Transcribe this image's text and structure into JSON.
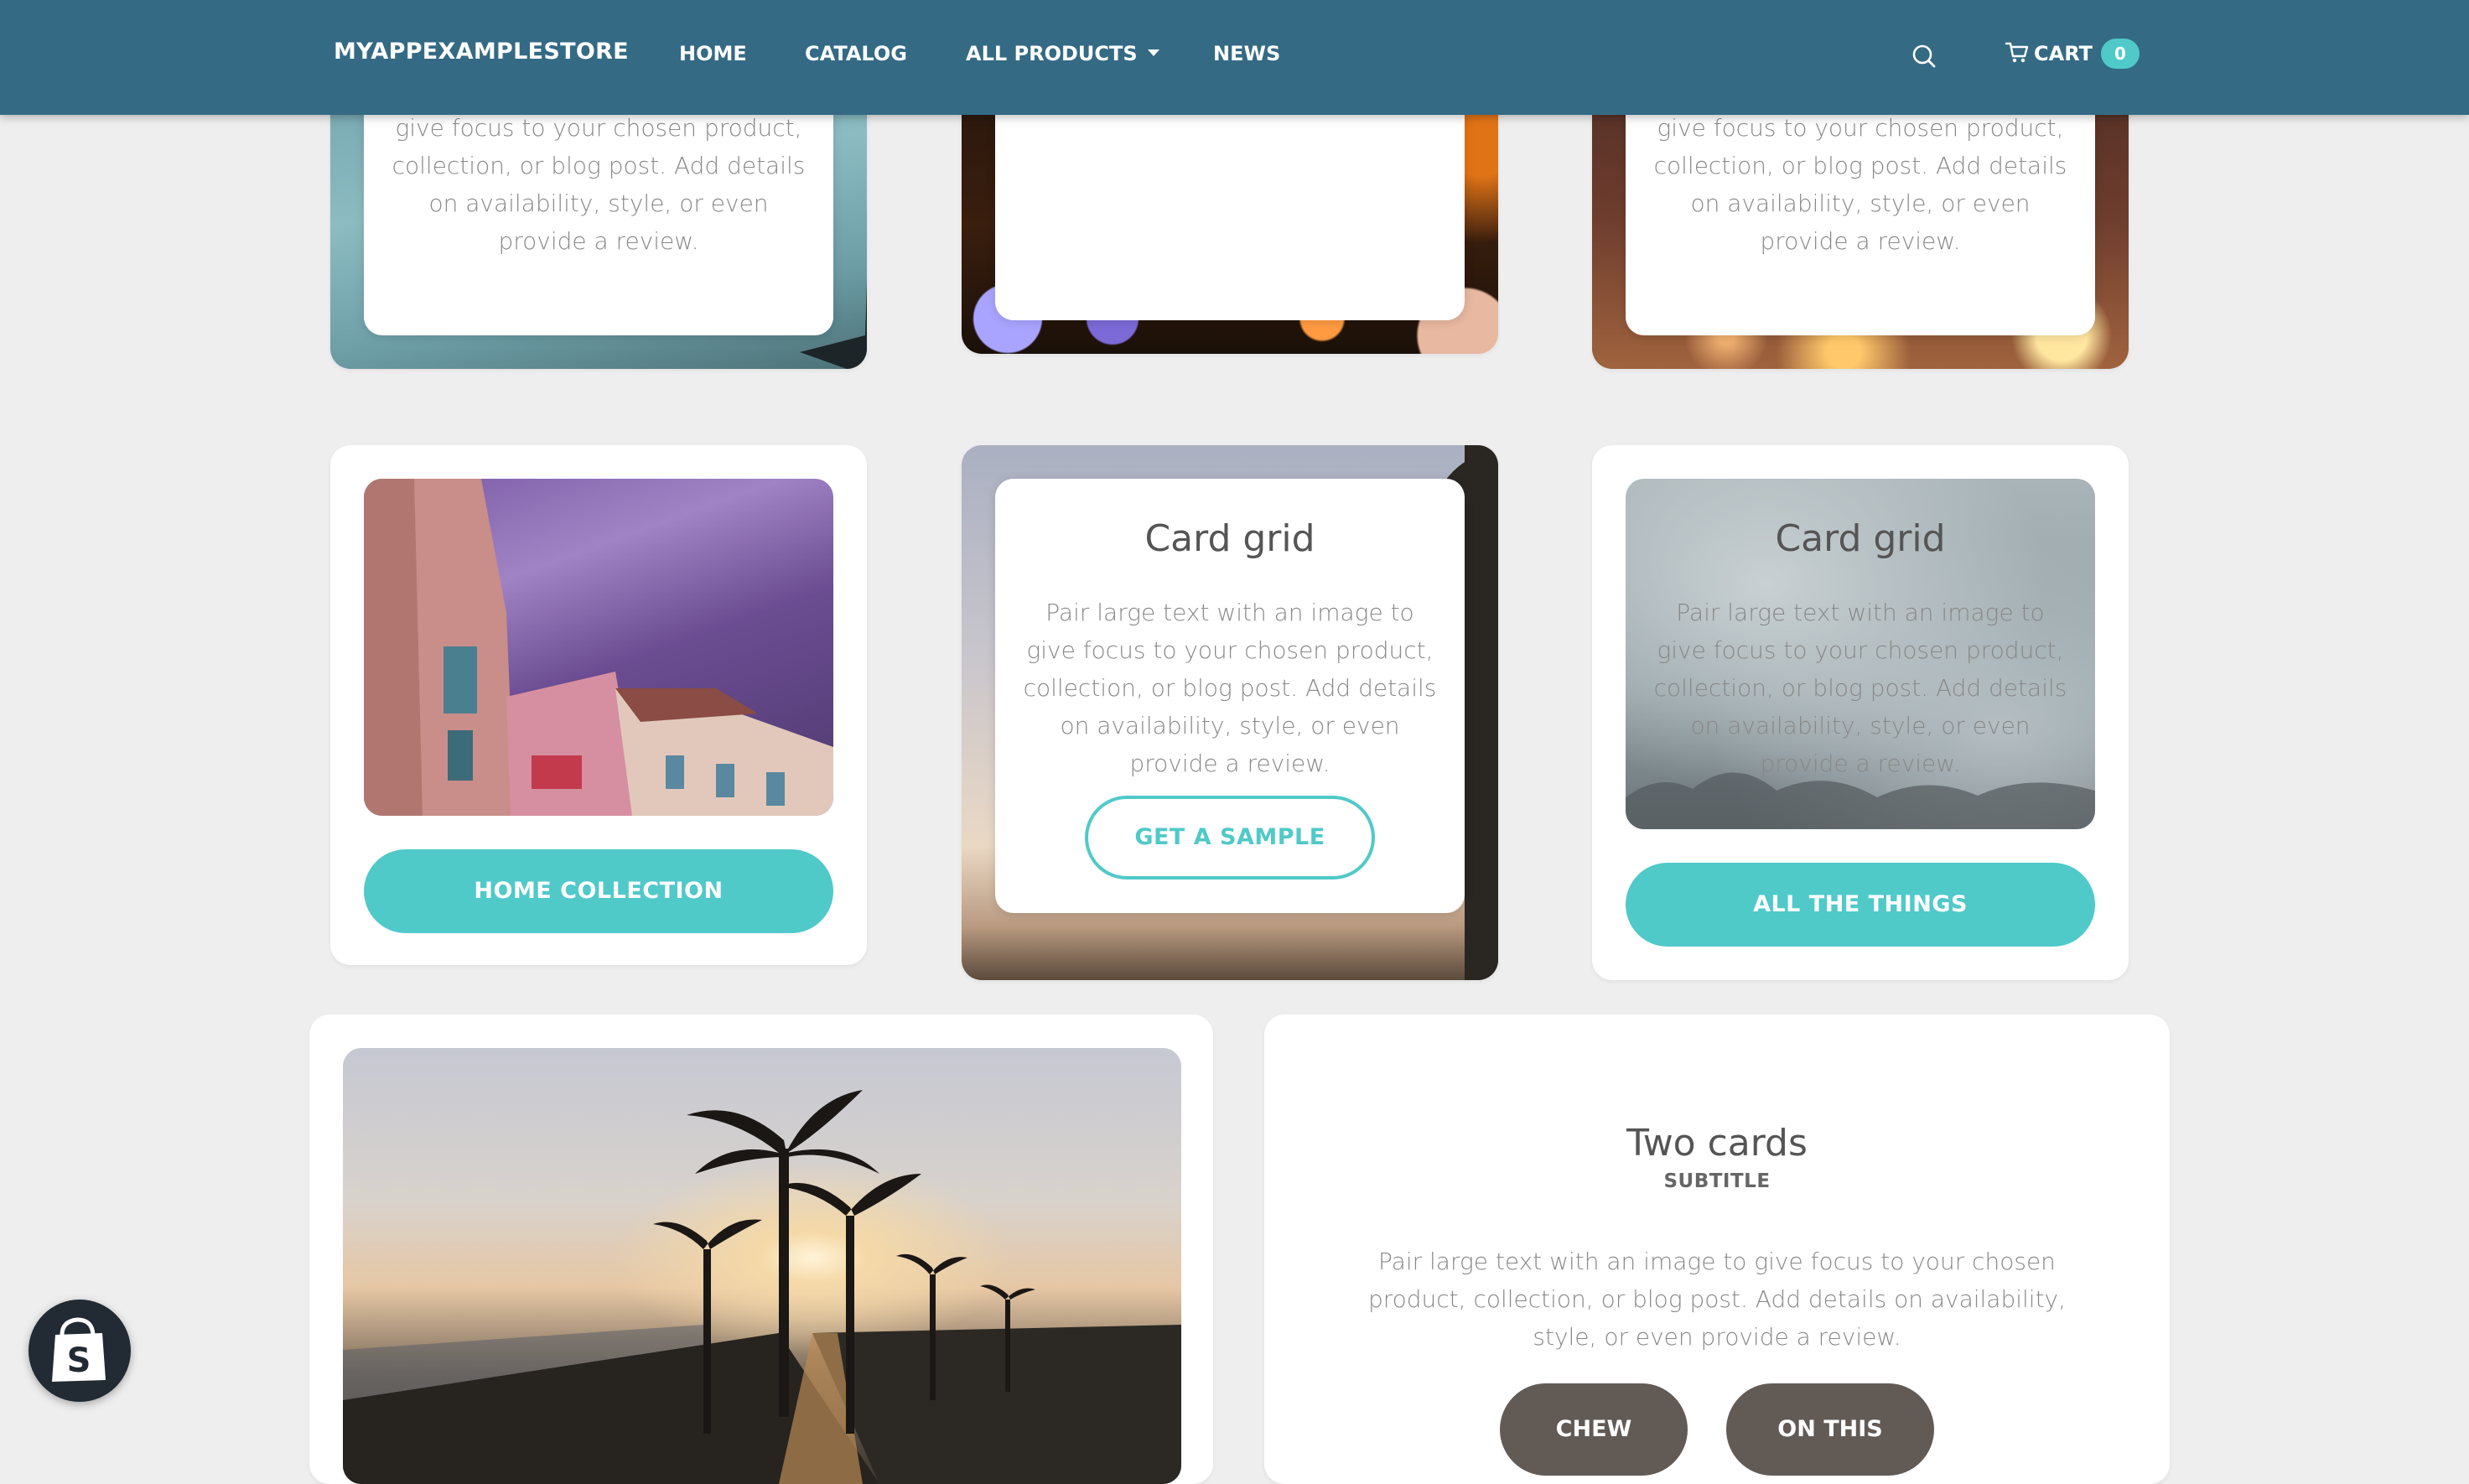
{
  "header": {
    "logo": "MYAPPEXAMPLESTORE",
    "nav": {
      "home": "HOME",
      "catalog": "CATALOG",
      "all_products": "ALL PRODUCTS",
      "news": "NEWS"
    },
    "search_icon": "search-icon",
    "cart_icon": "cart-icon",
    "cart_label": "CART",
    "cart_count": "0"
  },
  "colors": {
    "header_bg": "#346a84",
    "accent": "#50c9c9",
    "page_bg": "#eeeeee",
    "dark_button": "#625a55"
  },
  "top_row": {
    "left_text": "give focus to your chosen product, collection, or blog post. Add details on availability, style, or even provide a review.",
    "right_text": "give focus to your chosen product, collection, or blog post. Add details on availability, style, or even provide a review."
  },
  "middle_row": {
    "left_button": "HOME COLLECTION",
    "center_title": "Card grid",
    "center_text": "Pair large text with an image to give focus to your chosen product, collection, or blog post. Add details on availability, style, or even provide a review.",
    "center_button": "GET A SAMPLE",
    "right_title": "Card grid",
    "right_text": "Pair large text with an image to give focus to your chosen product, collection, or blog post. Add details on availability, style, or even provide a review.",
    "right_button": "ALL THE THINGS"
  },
  "bottom_row": {
    "title": "Two cards",
    "subtitle": "SUBTITLE",
    "text": "Pair large text with an image to give focus to your chosen product, collection, or blog post. Add details on availability, style, or even provide a review.",
    "button_1": "CHEW",
    "button_2": "ON THIS"
  },
  "shopify_badge_icon": "shopify-bag-icon"
}
